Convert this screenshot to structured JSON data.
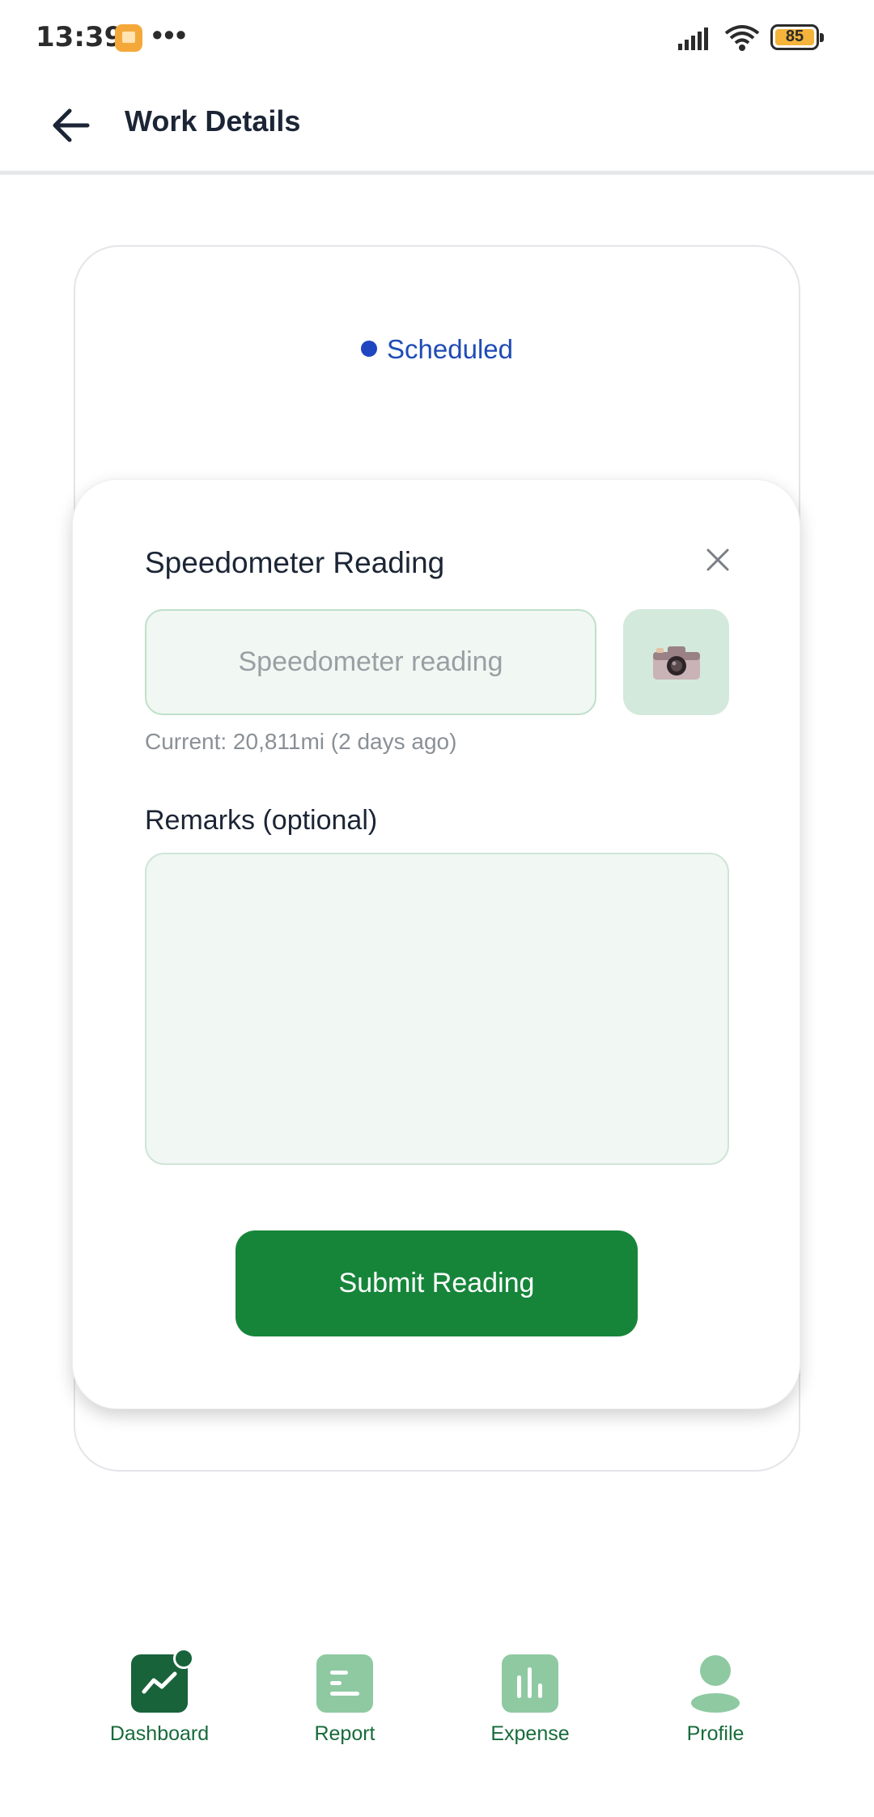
{
  "status_bar": {
    "time": "13:39",
    "dots": "•••",
    "battery": "85",
    "icons": [
      "app-notification-icon",
      "signal-icon",
      "wifi-icon",
      "battery-icon"
    ]
  },
  "header": {
    "title": "Work Details",
    "back_icon": "arrow-left-icon"
  },
  "work": {
    "status": "Scheduled",
    "status_color": "#1f45c0"
  },
  "modal": {
    "title": "Speedometer Reading",
    "close_icon": "close-icon",
    "speedometer_placeholder": "Speedometer reading",
    "speedometer_value": "",
    "camera_icon": "camera-icon",
    "current_note": "Current: 20,811mi (2 days ago)",
    "remarks_label": "Remarks (optional)",
    "remarks_value": "",
    "submit_label": "Submit Reading",
    "accent_color": "#16853a"
  },
  "bottom_nav": {
    "items": [
      {
        "label": "Dashboard",
        "icon": "dashboard-chart-icon",
        "active": true,
        "has_notification": true
      },
      {
        "label": "Report",
        "icon": "report-icon",
        "active": false
      },
      {
        "label": "Expense",
        "icon": "bar-chart-icon",
        "active": false
      },
      {
        "label": "Profile",
        "icon": "person-icon",
        "active": false
      }
    ]
  }
}
